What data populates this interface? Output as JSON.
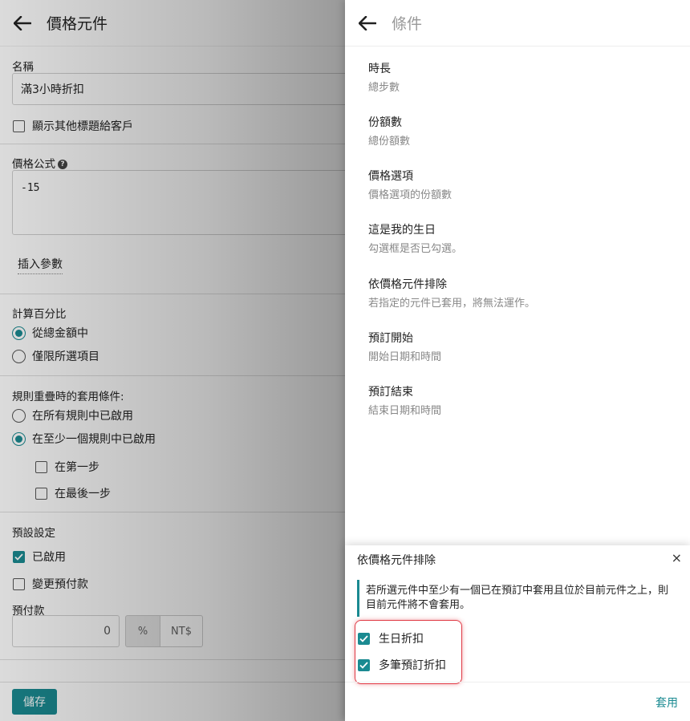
{
  "left": {
    "title": "價格元件",
    "name_label": "名稱",
    "name_value": "滿3小時折扣",
    "show_other_title_label": "顯示其他標題給客戶",
    "formula_label": "價格公式",
    "formula_value": "-15",
    "insert_param_label": "插入參數",
    "percent_label": "計算百分比",
    "percent_options": [
      "從總金額中",
      "僅限所選項目"
    ],
    "overlap_label": "規則重疊時的套用條件:",
    "overlap_options": [
      "在所有規則中已啟用",
      "在至少一個規則中已啟用"
    ],
    "step_options": [
      "在第一步",
      "在最後一步"
    ],
    "defaults_label": "預設設定",
    "enabled_label": "已啟用",
    "change_prepay_label": "變更預付款",
    "prepay_label": "預付款",
    "prepay_value": "0",
    "unit_percent": "%",
    "unit_currency": "NT$",
    "save_label": "儲存"
  },
  "right": {
    "title": "條件",
    "conditions": [
      {
        "title": "時長",
        "desc": "總步數"
      },
      {
        "title": "份額數",
        "desc": "總份額數"
      },
      {
        "title": "價格選項",
        "desc": "價格選項的份額數"
      },
      {
        "title": "這是我的生日",
        "desc": "勾選框是否已勾選。"
      },
      {
        "title": "依價格元件排除",
        "desc": "若指定的元件已套用，將無法運作。"
      },
      {
        "title": "預訂開始",
        "desc": "開始日期和時間"
      },
      {
        "title": "預訂結束",
        "desc": "結束日期和時間"
      }
    ]
  },
  "popup": {
    "title": "依價格元件排除",
    "close": "×",
    "notice": "若所選元件中至少有一個已在預訂中套用且位於目前元件之上，則目前元件將不會套用。",
    "options": [
      "生日折扣",
      "多筆預訂折扣"
    ],
    "apply_label": "套用"
  },
  "colors": {
    "accent": "#1a8a91",
    "highlight": "#e03a45"
  }
}
